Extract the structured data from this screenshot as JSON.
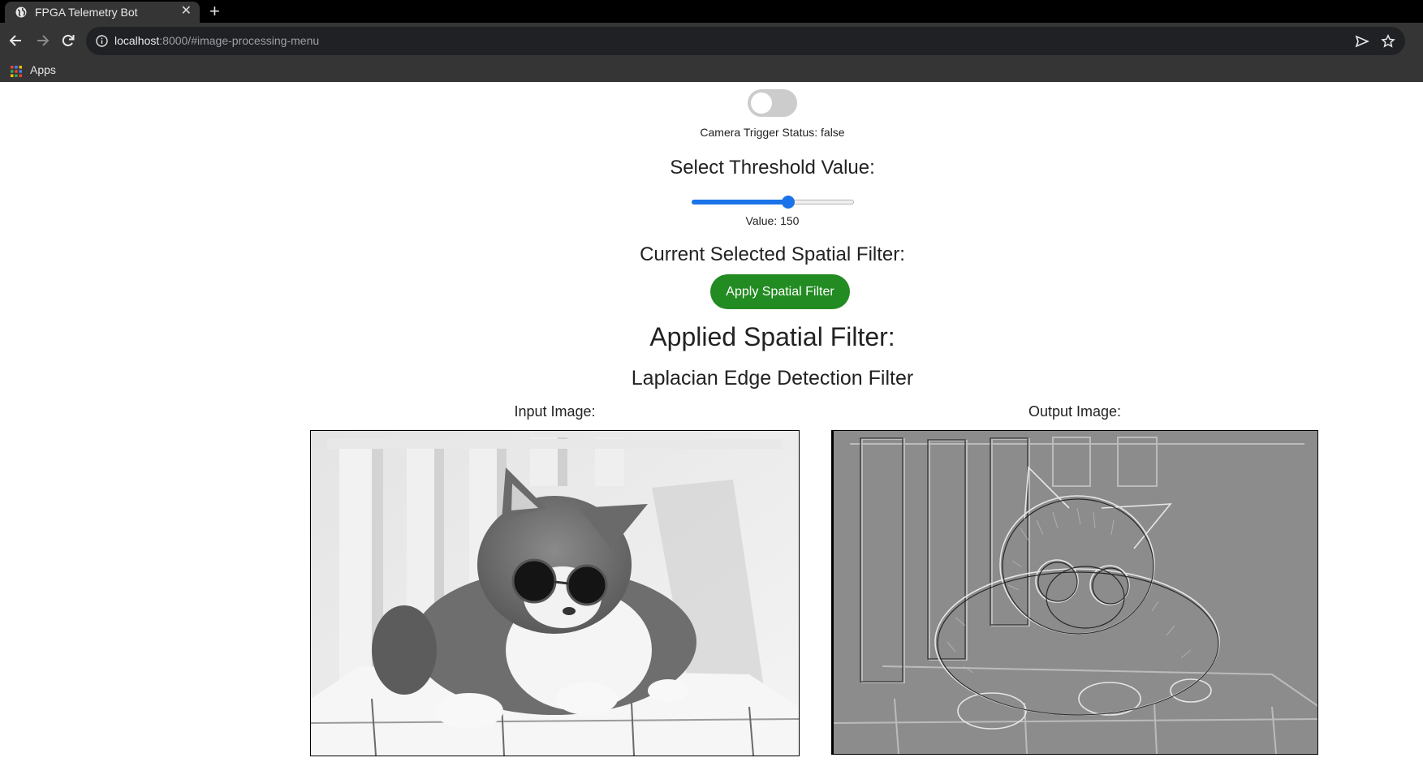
{
  "browser": {
    "tab_title": "FPGA Telemetry Bot",
    "url_host": "localhost",
    "url_rest": ":8000/#image-processing-menu",
    "bookmarks_apps": "Apps"
  },
  "camera": {
    "toggle_on": false,
    "status_label": "Camera Trigger Status: false"
  },
  "threshold": {
    "heading": "Select Threshold Value:",
    "value": 150,
    "min": 0,
    "max": 255,
    "value_label": "Value: 150"
  },
  "spatial_filter": {
    "current_heading": "Current Selected Spatial Filter:",
    "apply_button": "Apply Spatial Filter",
    "applied_heading": "Applied Spatial Filter:",
    "applied_name": "Laplacian Edge Detection Filter"
  },
  "images": {
    "input_label": "Input Image:",
    "output_label": "Output Image:"
  }
}
